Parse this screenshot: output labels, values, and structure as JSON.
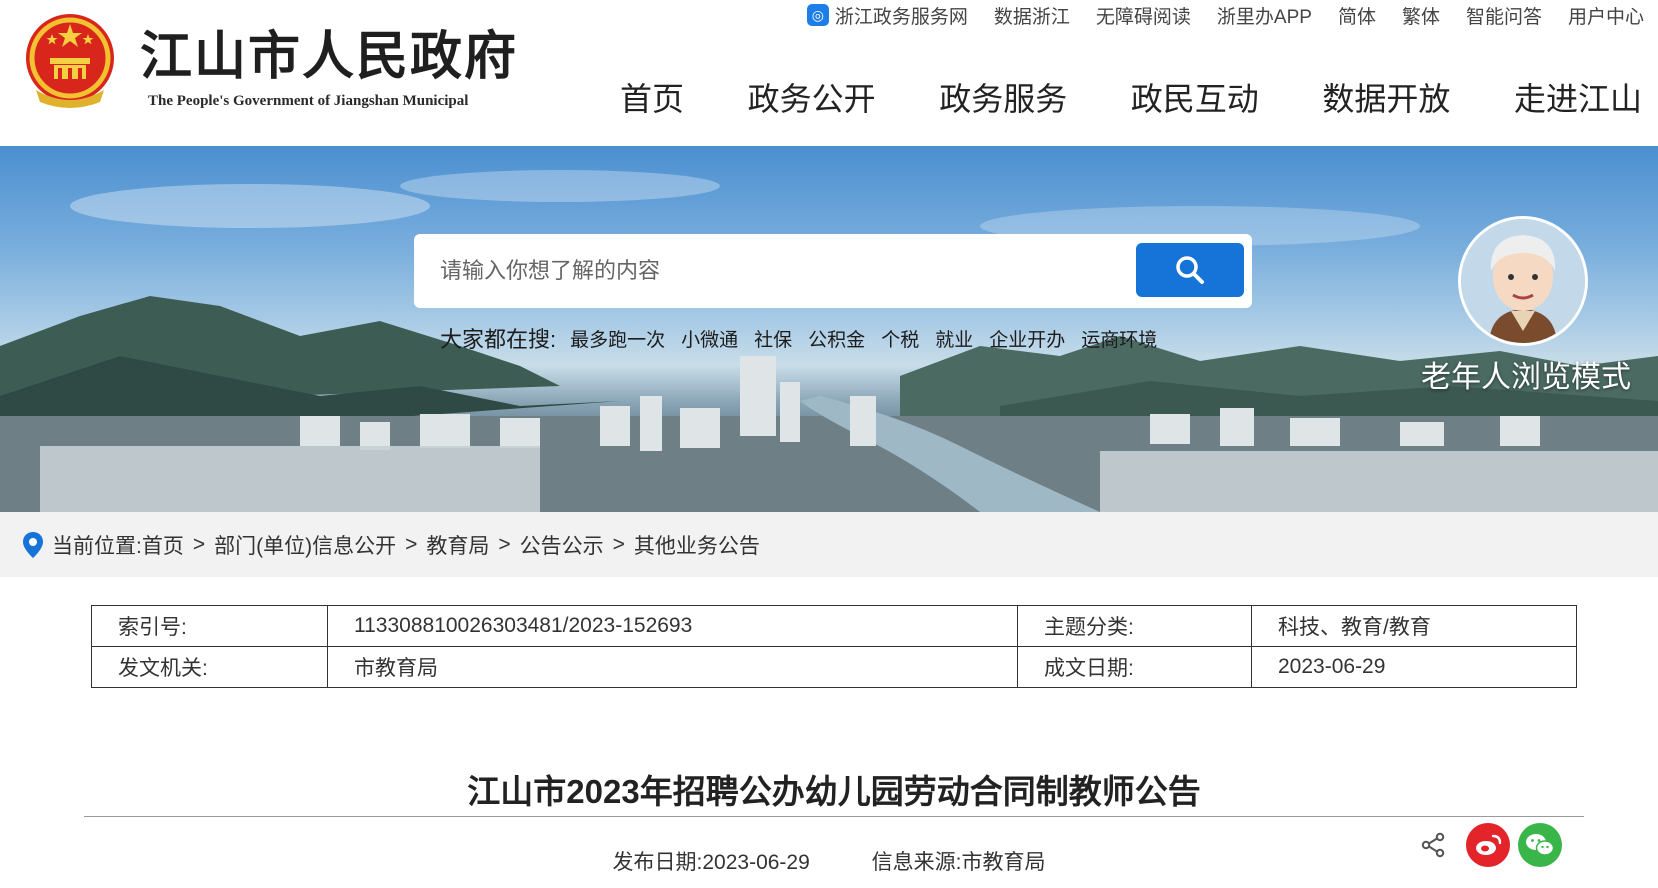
{
  "header": {
    "title_cn": "江山市人民政府",
    "title_en": "The People's Government of Jiangshan Municipal",
    "toplinks": [
      "浙江政务服务网",
      "数据浙江",
      "无障碍阅读",
      "浙里办APP",
      "简体",
      "繁体",
      "智能问答",
      "用户中心"
    ],
    "nav": [
      "首页",
      "政务公开",
      "政务服务",
      "政民互动",
      "数据开放",
      "走进江山"
    ]
  },
  "search": {
    "placeholder": "请输入你想了解的内容",
    "hot_label": "大家都在搜:",
    "hot_items": [
      "最多跑一次",
      "小微通",
      "社保",
      "公积金",
      "个税",
      "就业",
      "企业开办",
      "运商环境"
    ]
  },
  "elder_mode": {
    "label": "老年人浏览模式"
  },
  "breadcrumb": {
    "label": "当前位置:",
    "items": [
      "首页",
      "部门(单位)信息公开",
      "教育局",
      "公告公示",
      "其他业务公告"
    ],
    "separator": ">"
  },
  "info": {
    "index_label": "索引号:",
    "index_value": "113308810026303481/2023-152693",
    "topic_label": "主题分类:",
    "topic_value": "科技、教育/教育",
    "issuer_label": "发文机关:",
    "issuer_value": "市教育局",
    "date_label": "成文日期:",
    "date_value": "2023-06-29"
  },
  "article": {
    "title": "江山市2023年招聘公办幼儿园劳动合同制教师公告",
    "publish_label": "发布日期:",
    "publish_date": "2023-06-29",
    "source_label": "信息来源:",
    "source_value": "市教育局"
  },
  "colors": {
    "accent": "#1674d8",
    "weibo": "#e3242b",
    "wechat": "#39b54a"
  }
}
